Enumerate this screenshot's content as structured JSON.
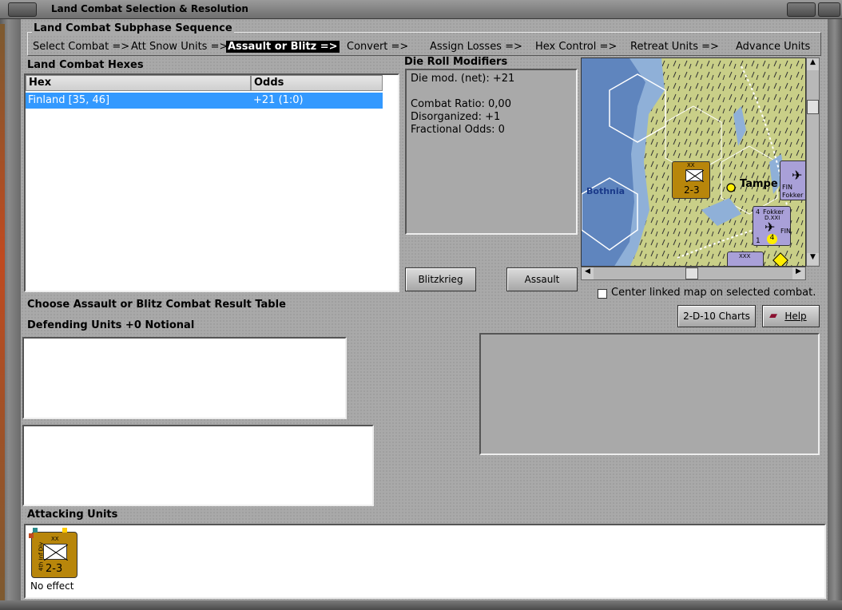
{
  "window": {
    "title": "Land Combat Selection & Resolution"
  },
  "subphase": {
    "label": "Land Combat Subphase Sequence",
    "steps": [
      "Select Combat =>",
      "Att Snow Units =>",
      "Assault or Blitz =>",
      "Convert =>",
      "Assign Losses =>",
      "Hex Control =>",
      "Retreat Units =>",
      "Advance Units"
    ],
    "active_index": 2
  },
  "hexes": {
    "label": "Land Combat Hexes",
    "columns": [
      "Hex",
      "Odds"
    ],
    "rows": [
      {
        "hex": "Finland [35, 46]",
        "odds": "+21 (1:0)"
      }
    ]
  },
  "drm": {
    "label": "Die Roll Modifiers",
    "lines": [
      "Die mod. (net): +21",
      "",
      "Combat Ratio: 0,00",
      "Disorganized: +1",
      "Fractional Odds: 0"
    ]
  },
  "buttons": {
    "blitzkrieg": "Blitzkrieg",
    "assault": "Assault",
    "charts": "2-D-10 Charts",
    "help": "Help"
  },
  "map": {
    "center_checkbox_label": "Center linked map on selected combat.",
    "center_checked": false,
    "labels": {
      "sea": "Bothnia",
      "city": "Tampe"
    },
    "units": [
      {
        "id": "inf",
        "strength": "2-3",
        "size": "XX",
        "side": "4th Inf Div"
      },
      {
        "id": "fokker1",
        "name": "Fokker",
        "tag": "FIN"
      },
      {
        "id": "fokker2",
        "name": "Fokker",
        "model": "D.XXI",
        "tag": "FIN",
        "top": "4",
        "bottom_left": "1",
        "bottom_mid": "4"
      },
      {
        "id": "corps",
        "size": "XXX"
      }
    ]
  },
  "sections": {
    "choose_crt": "Choose Assault or Blitz Combat Result Table",
    "defending": "Defending Units +0 Notional",
    "attacking": "Attacking Units"
  },
  "attacker": {
    "strength": "2-3",
    "size": "XX",
    "side": "4th Inf Div",
    "result": "No effect"
  },
  "colors": {
    "unit_bg": "#b8860b",
    "selection": "#3399ff",
    "active_step_bg": "#000000"
  }
}
